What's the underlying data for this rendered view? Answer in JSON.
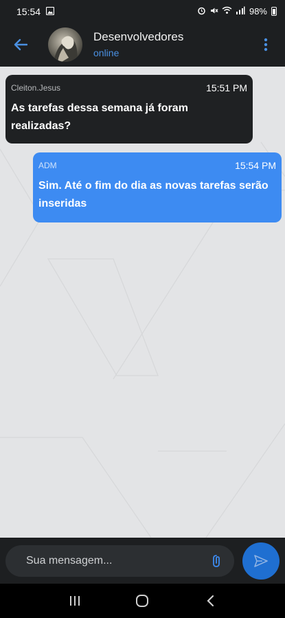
{
  "status_bar": {
    "time": "15:54",
    "battery": "98%"
  },
  "header": {
    "title": "Desenvolvedores",
    "status": "online"
  },
  "messages": [
    {
      "direction": "incoming",
      "sender": "Cleiton.Jesus",
      "time": "15:51 PM",
      "text": "As tarefas dessa semana já foram realizadas?"
    },
    {
      "direction": "outgoing",
      "sender": "ADM",
      "time": "15:54 PM",
      "text": "Sim. Até o fim do dia as novas tarefas serão inseridas"
    }
  ],
  "composer": {
    "placeholder": "Sua mensagem..."
  },
  "colors": {
    "accent": "#3d8bf2",
    "send_button": "#1f6fd1",
    "bar_bg": "#1d1f21",
    "chat_bg": "#e3e4e6",
    "incoming_bubble": "#1f2123"
  },
  "icons": [
    "back-arrow-icon",
    "avatar",
    "more-vert-icon",
    "attach-icon",
    "send-icon",
    "recents-icon",
    "home-icon",
    "back-icon"
  ]
}
